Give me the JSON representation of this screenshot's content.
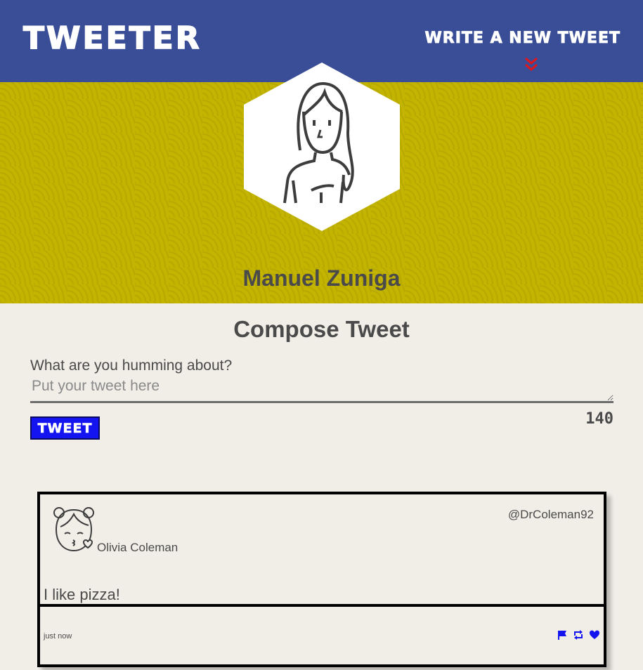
{
  "nav": {
    "brand": "Tweeter",
    "write_new": "Write a new tweet",
    "chevron_icon": "double-chevron-down-icon",
    "colors": {
      "background": "#3a4d97",
      "chevron": "#e0161b"
    }
  },
  "profile": {
    "name": "Manuel Zuniga",
    "avatar_icon": "woman-avatar-icon",
    "banner_color": "#c2b400"
  },
  "compose": {
    "title": "Compose Tweet",
    "label": "What are you humming about?",
    "placeholder": "Put your tweet here",
    "button_label": "Tweet",
    "counter": "140",
    "button_color": "#1414f0"
  },
  "tweets": [
    {
      "author": "Olivia Coleman",
      "handle": "@DrColeman92",
      "body": "I like pizza!",
      "time": "just now",
      "avatar_icon": "girl-kiss-avatar-icon",
      "actions": [
        "flag-icon",
        "retweet-icon",
        "heart-icon"
      ],
      "action_color": "#1414f0"
    }
  ]
}
